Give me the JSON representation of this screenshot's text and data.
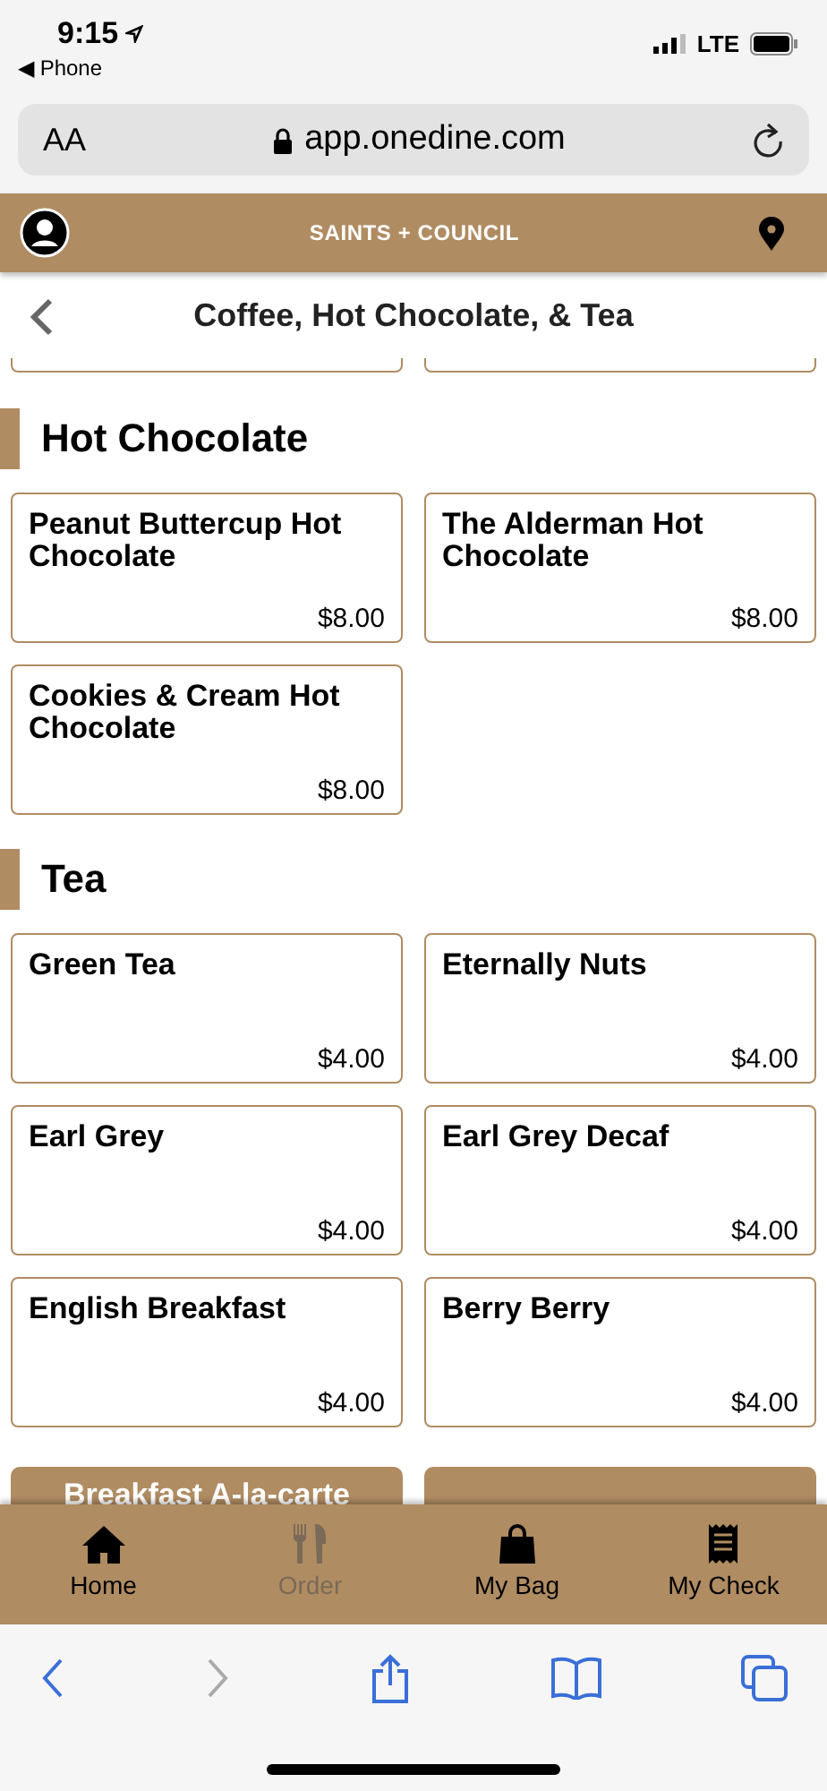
{
  "status_bar": {
    "time": "9:15",
    "back_label": "◀ Phone",
    "network": "LTE"
  },
  "browser": {
    "text_size": "AA",
    "url": "app.onedine.com"
  },
  "header": {
    "brand": "SAINTS + COUNCIL"
  },
  "page_title": "Coffee, Hot Chocolate, & Tea",
  "sections": [
    {
      "title": "Hot Chocolate",
      "items": [
        {
          "name": "Peanut Buttercup Hot Chocolate",
          "price": "$8.00"
        },
        {
          "name": "The Alderman Hot Chocolate",
          "price": "$8.00"
        },
        {
          "name": "Cookies & Cream Hot Chocolate",
          "price": "$8.00"
        }
      ]
    },
    {
      "title": "Tea",
      "items": [
        {
          "name": "Green Tea",
          "price": "$4.00"
        },
        {
          "name": "Eternally Nuts",
          "price": "$4.00"
        },
        {
          "name": "Earl Grey",
          "price": "$4.00"
        },
        {
          "name": "Earl Grey Decaf",
          "price": "$4.00"
        },
        {
          "name": "English Breakfast",
          "price": "$4.00"
        },
        {
          "name": "Berry Berry",
          "price": "$4.00"
        }
      ]
    }
  ],
  "categories": [
    {
      "kind": "tile",
      "label": "Breakfast A-la-carte"
    },
    {
      "kind": "tile"
    }
  ],
  "tabs": [
    {
      "kind": "home",
      "label": "Home",
      "disabled": false
    },
    {
      "kind": "order",
      "label": "Order",
      "disabled": true
    },
    {
      "kind": "bag",
      "label": "My Bag",
      "disabled": false
    },
    {
      "kind": "check",
      "label": "My Check",
      "disabled": false
    }
  ]
}
